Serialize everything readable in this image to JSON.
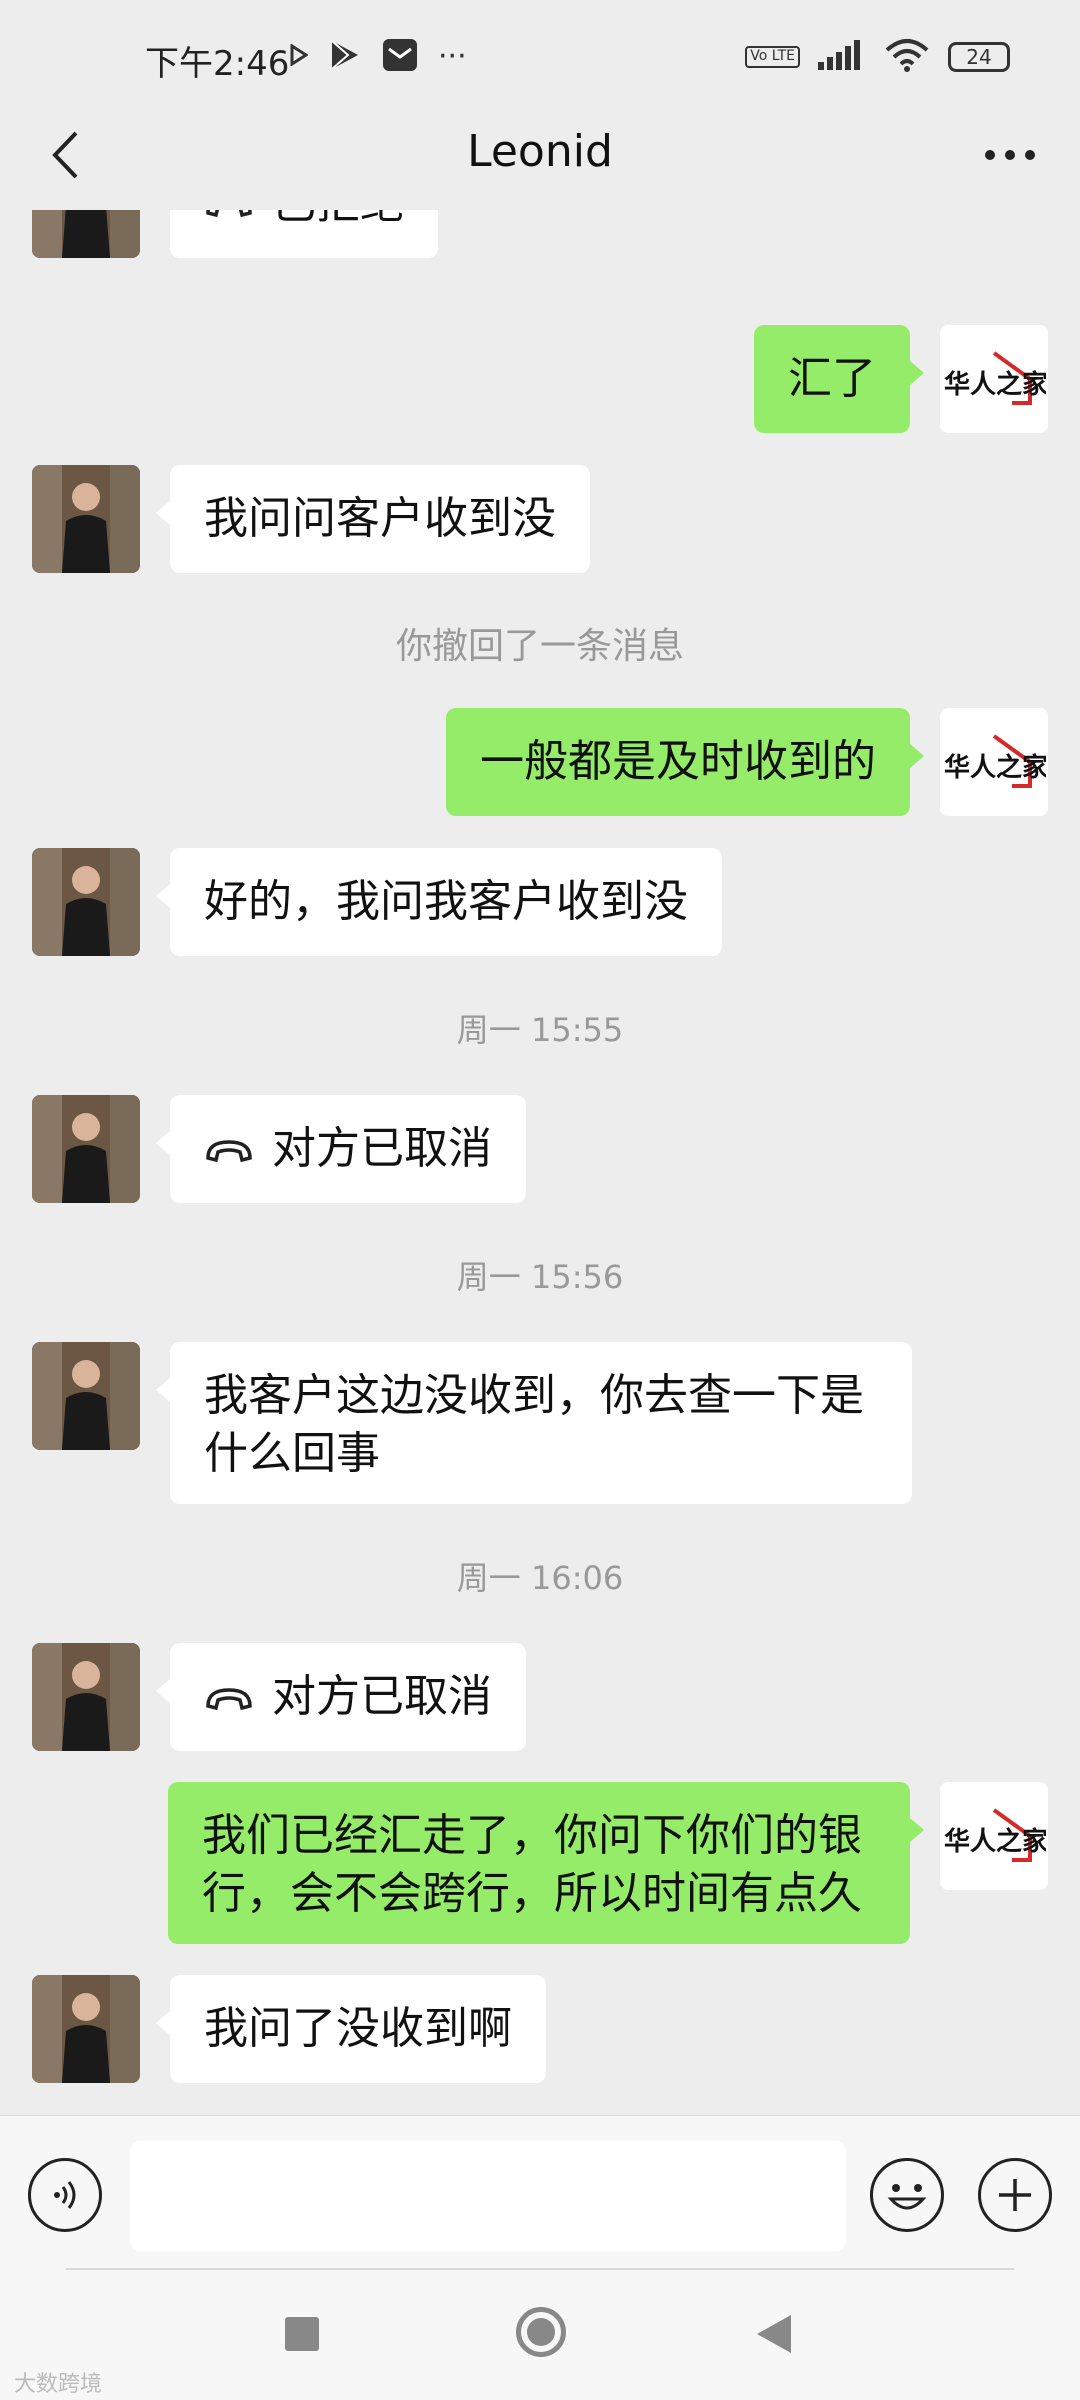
{
  "status_bar": {
    "time": "下午2:46",
    "left_icons": [
      "play-small-icon",
      "play-store-icon",
      "mail-icon",
      "more-dots-icon"
    ],
    "right_icons": [
      "volte-icon",
      "signal-icon",
      "wifi-icon",
      "battery-icon"
    ],
    "volte_label": "Vo LTE",
    "battery_level": "24",
    "more_dots": "···"
  },
  "header": {
    "title": "Leonid",
    "back_icon": "chevron-left-icon",
    "more_icon": "more-dots-icon"
  },
  "messages": [
    {
      "kind": "call",
      "side": "in",
      "text": "已拒绝"
    },
    {
      "kind": "text",
      "side": "out",
      "text": "汇了"
    },
    {
      "kind": "text",
      "side": "in",
      "text": "我问问客户收到没"
    },
    {
      "kind": "system",
      "text": "你撤回了一条消息"
    },
    {
      "kind": "text",
      "side": "out",
      "text": "一般都是及时收到的"
    },
    {
      "kind": "text",
      "side": "in",
      "text": "好的，我问我客户收到没"
    },
    {
      "kind": "timestamp",
      "text": "周一 15:55"
    },
    {
      "kind": "call",
      "side": "in",
      "text": "对方已取消"
    },
    {
      "kind": "timestamp",
      "text": "周一 15:56"
    },
    {
      "kind": "text",
      "side": "in",
      "lines": [
        "我客户这边没收到，你去查一下是",
        "什么回事"
      ]
    },
    {
      "kind": "timestamp",
      "text": "周一 16:06"
    },
    {
      "kind": "call",
      "side": "in",
      "text": "对方已取消"
    },
    {
      "kind": "text",
      "side": "out",
      "lines": [
        "我们已经汇走了，你问下你们的银",
        "行，会不会跨行，所以时间有点久"
      ]
    },
    {
      "kind": "text",
      "side": "in",
      "text": "我问了没收到啊"
    }
  ],
  "my_avatar_logo": "华人之家",
  "input_bar": {
    "voice_icon": "voice-icon",
    "input_value": "",
    "emoji_icon": "emoji-icon",
    "plus_icon": "plus-icon"
  },
  "nav_bar": {
    "icons": [
      "recent-apps-icon",
      "home-icon",
      "back-triangle-icon"
    ]
  },
  "watermark": "大数跨境",
  "colors": {
    "background": "#ededed",
    "bubble_in": "#ffffff",
    "bubble_out": "#95ec69",
    "system_text": "#999999",
    "logo_red": "#d42a2a"
  }
}
